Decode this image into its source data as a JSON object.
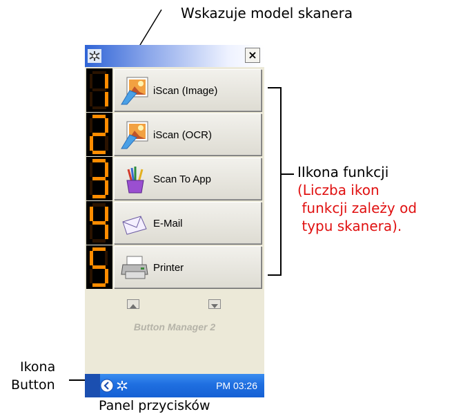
{
  "annotations": {
    "model": "Wskazuje model skanera",
    "function_icon": "IIkona funkcji",
    "function_note_lines": [
      "(Liczba ikon",
      " funkcji zależy od",
      " typu skanera)."
    ],
    "button_icon_lines": [
      "Ikona",
      "Button"
    ],
    "caption": "Panel przycisków",
    "note_color": "#e01010"
  },
  "panel": {
    "title_bar": {
      "model_text": "",
      "close_label": "×",
      "icon": "scanner-icon"
    },
    "buttons": [
      {
        "number": "1",
        "label": "iScan (Image)",
        "icon": "image-scan-icon"
      },
      {
        "number": "2",
        "label": "iScan (OCR)",
        "icon": "ocr-scan-icon"
      },
      {
        "number": "3",
        "label": "Scan To App",
        "icon": "paint-cup-icon"
      },
      {
        "number": "4",
        "label": "E-Mail",
        "icon": "envelope-icon"
      },
      {
        "number": "5",
        "label": "Printer",
        "icon": "printer-icon"
      }
    ],
    "nav": {
      "up_icon": "triangle-up-icon",
      "down_icon": "triangle-down-icon"
    },
    "brand": "Button Manager 2",
    "taskbar": {
      "time": "PM 03:26",
      "tray_icon": "scanner-icon",
      "back_icon": "back-arrow-icon"
    },
    "digit_color": "#ff8c00"
  }
}
